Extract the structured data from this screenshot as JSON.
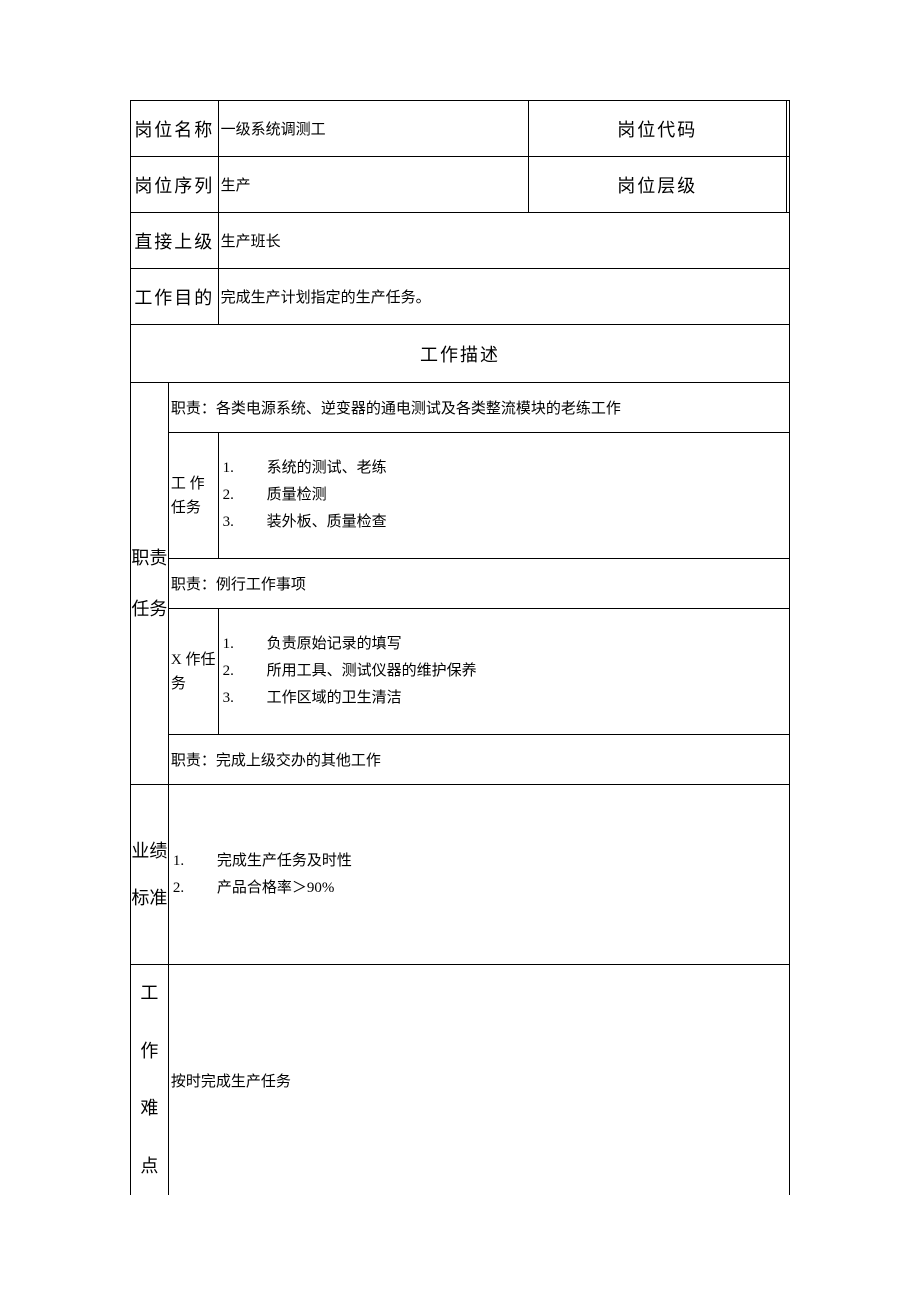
{
  "header": {
    "position_name_label": "岗位名称",
    "position_name_value": "一级系统调测工",
    "position_code_label": "岗位代码",
    "position_code_value": "",
    "position_series_label": "岗位序列",
    "position_series_value": "生产",
    "position_level_label": "岗位层级",
    "position_level_value": "",
    "supervisor_label": "直接上级",
    "supervisor_value": "生产班长",
    "purpose_label": "工作目的",
    "purpose_value": "完成生产计划指定的生产任务。"
  },
  "section_title": "工作描述",
  "duties": {
    "side_label_1": "职责",
    "side_label_2": "任务",
    "duty1_title": "职责：各类电源系统、逆变器的通电测试及各类整流模块的老练工作",
    "task1_label": "工 作任务",
    "task1_items": [
      {
        "n": "1.",
        "t": "系统的测试、老练"
      },
      {
        "n": "2.",
        "t": "质量检测"
      },
      {
        "n": "3.",
        "t": "装外板、质量检查"
      }
    ],
    "duty2_title": "职责：例行工作事项",
    "task2_label": "X 作任务",
    "task2_items": [
      {
        "n": "1.",
        "t": "负责原始记录的填写"
      },
      {
        "n": "2.",
        "t": " 所用工具、测试仪器的维护保养"
      },
      {
        "n": "3.",
        "t": "工作区域的卫生清洁"
      }
    ],
    "duty3_title": "职责：完成上级交办的其他工作"
  },
  "performance": {
    "label_1": "业绩",
    "label_2": "标准",
    "items": [
      {
        "n": "1.",
        "t": "完成生产任务及时性"
      },
      {
        "n": "2.",
        "t": "产品合格率＞90%"
      }
    ]
  },
  "difficulty": {
    "label_chars": [
      "工",
      "作",
      "难",
      "点"
    ],
    "value": "按时完成生产任务"
  }
}
